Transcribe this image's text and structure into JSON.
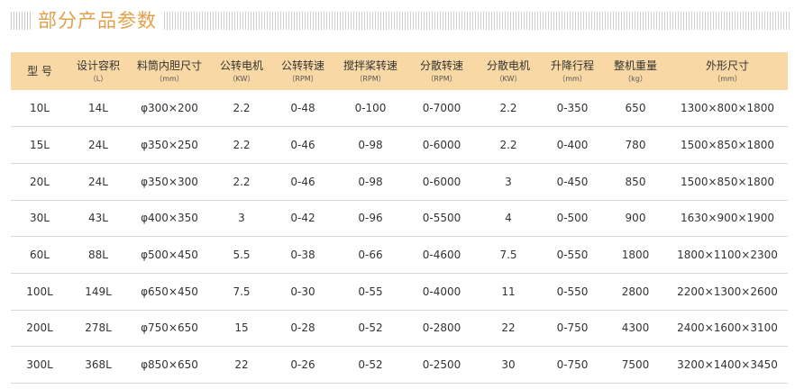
{
  "title": "部分产品参数",
  "accent_color": "#e3a04a",
  "header_bg": "#f8d8a4",
  "columns": [
    {
      "label": "型 号",
      "unit": ""
    },
    {
      "label": "设计容积",
      "unit": "（L）"
    },
    {
      "label": "料筒内胆尺寸",
      "unit": "（mm）"
    },
    {
      "label": "公转电机",
      "unit": "（KW）"
    },
    {
      "label": "公转转速",
      "unit": "（RPM）"
    },
    {
      "label": "搅拌桨转速",
      "unit": "（RPM）"
    },
    {
      "label": "分散转速",
      "unit": "（RPM）"
    },
    {
      "label": "分散电机",
      "unit": "（KW）"
    },
    {
      "label": "升降行程",
      "unit": "（mm）"
    },
    {
      "label": "整机重量",
      "unit": "（kg）"
    },
    {
      "label": "外形尺寸",
      "unit": "（mm）"
    }
  ],
  "rows": [
    [
      "10L",
      "14L",
      "φ300×200",
      "2.2",
      "0-48",
      "0-100",
      "0-7000",
      "2.2",
      "0-350",
      "650",
      "1300×800×1800"
    ],
    [
      "15L",
      "24L",
      "φ350×250",
      "2.2",
      "0-46",
      "0-98",
      "0-6000",
      "2.2",
      "0-400",
      "780",
      "1500×850×1800"
    ],
    [
      "20L",
      "24L",
      "φ350×300",
      "2.2",
      "0-46",
      "0-98",
      "0-6000",
      "3",
      "0-450",
      "850",
      "1500×850×1800"
    ],
    [
      "30L",
      "43L",
      "φ400×350",
      "3",
      "0-42",
      "0-96",
      "0-5500",
      "4",
      "0-500",
      "900",
      "1630×900×1900"
    ],
    [
      "60L",
      "88L",
      "φ500×450",
      "5.5",
      "0-38",
      "0-66",
      "0-4600",
      "7.5",
      "0-550",
      "1800",
      "1800×1100×2300"
    ],
    [
      "100L",
      "149L",
      "φ650×450",
      "7.5",
      "0-30",
      "0-55",
      "0-4000",
      "11",
      "0-550",
      "2800",
      "2200×1300×2600"
    ],
    [
      "200L",
      "278L",
      "φ750×650",
      "15",
      "0-28",
      "0-52",
      "0-2800",
      "22",
      "0-750",
      "4300",
      "2400×1600×3100"
    ],
    [
      "300L",
      "368L",
      "φ850×650",
      "22",
      "0-26",
      "0-52",
      "0-2500",
      "30",
      "0-750",
      "7500",
      "3200×1400×3450"
    ]
  ]
}
